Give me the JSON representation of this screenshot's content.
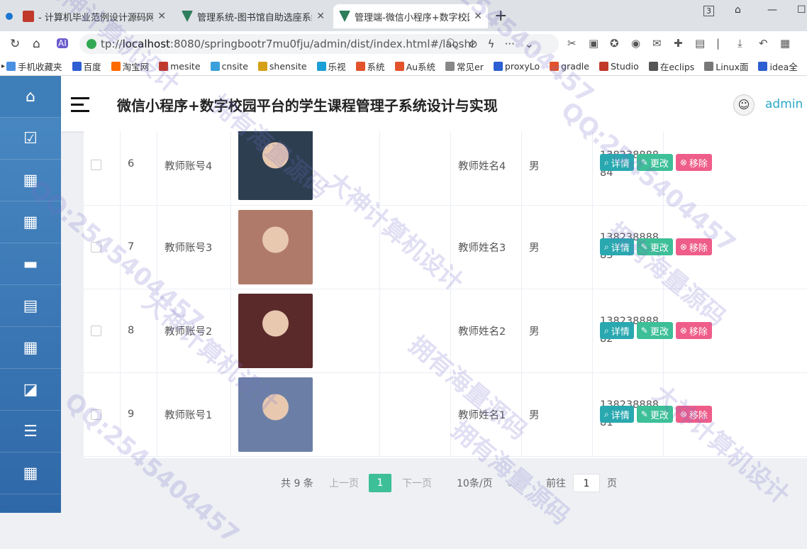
{
  "browser": {
    "tabs": [
      {
        "title": "- 计算机毕业范例设计源码网",
        "color": "#c0392b",
        "active": false
      },
      {
        "title": "管理系统-图书馆自助选座系统",
        "color": "#2e7d5b",
        "active": false
      },
      {
        "title": "管理端-微信小程序+数字校园",
        "color": "#2e7d5b",
        "active": true
      }
    ],
    "url_prefix": "tp://",
    "url_host": "localhost",
    "url_rest": ":8080/springbootr7mu0fju/admin/dist/index.html#/laoshi",
    "bookmarks": [
      "手机收藏夹",
      "百度",
      "淘宝网",
      "mesite",
      "cnsite",
      "shensite",
      "乐视",
      "系统",
      "Au系统",
      "常见er",
      "proxyLo",
      "gradle",
      "Studio",
      "在eclips",
      "Linux面",
      "idea全"
    ]
  },
  "app": {
    "title": "微信小程序+数字校园平台的学生课程管理子系统设计与实现",
    "username": "admin"
  },
  "sidebar": {
    "icons": [
      "home-icon",
      "clipboard-icon",
      "grid-icon",
      "grid-icon",
      "briefcase-icon",
      "clipboard-list-icon",
      "grid-icon",
      "chart-icon",
      "sliders-icon",
      "grid-icon"
    ]
  },
  "actions": {
    "detail": "详情",
    "edit": "更改",
    "delete": "移除"
  },
  "rows": [
    {
      "index": "6",
      "account": "教师账号4",
      "name": "教师姓名4",
      "gender": "男",
      "phone1": "138238888",
      "phone2": "84",
      "photo": "#2c3e50"
    },
    {
      "index": "7",
      "account": "教师账号3",
      "name": "教师姓名3",
      "gender": "男",
      "phone1": "138238888",
      "phone2": "83",
      "photo": "#b07a6a"
    },
    {
      "index": "8",
      "account": "教师账号2",
      "name": "教师姓名2",
      "gender": "男",
      "phone1": "138238888",
      "phone2": "82",
      "photo": "#5a2a2a"
    },
    {
      "index": "9",
      "account": "教师账号1",
      "name": "教师姓名1",
      "gender": "男",
      "phone1": "138238888",
      "phone2": "81",
      "photo": "#6b7fa6"
    }
  ],
  "pagination": {
    "total": "共 9 条",
    "prev": "上一页",
    "current": "1",
    "next": "下一页",
    "page_size": "10条/页",
    "goto": "前往",
    "goto_value": "1",
    "unit": "页"
  },
  "watermark": [
    "大神计算机设计",
    "QQ:2545404457",
    "拥有海量源码"
  ]
}
